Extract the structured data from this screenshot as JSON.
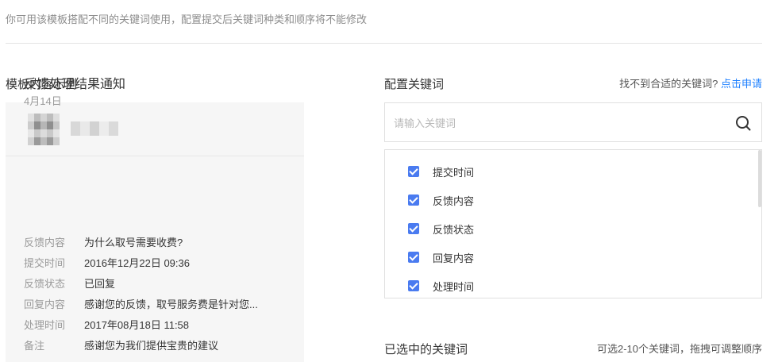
{
  "notice": "你可用该模板搭配不同的关键词使用，配置提交后关键词种类和顺序将不能修改",
  "template_section": {
    "title": "模板内容示例",
    "message": {
      "title": "反馈处理结果通知",
      "date": "4月14日",
      "fields": [
        {
          "key": "反馈内容",
          "value": "为什么取号需要收费?"
        },
        {
          "key": "提交时间",
          "value": "2016年12月22日 09:36"
        },
        {
          "key": "反馈状态",
          "value": "已回复"
        },
        {
          "key": "回复内容",
          "value": "感谢您的反馈，取号服务费是针对您..."
        },
        {
          "key": "处理时间",
          "value": "2017年08月18日 11:58"
        },
        {
          "key": "备注",
          "value": "感谢您为我们提供宝贵的建议"
        }
      ]
    }
  },
  "config_section": {
    "title": "配置关键词",
    "hint_text": "找不到合适的关键词?",
    "hint_link": "点击申请",
    "search": {
      "placeholder": "请输入关键词",
      "value": ""
    },
    "keywords": [
      {
        "label": "提交时间",
        "checked": true
      },
      {
        "label": "反馈内容",
        "checked": true
      },
      {
        "label": "反馈状态",
        "checked": true
      },
      {
        "label": "回复内容",
        "checked": true
      },
      {
        "label": "处理时间",
        "checked": true
      }
    ]
  },
  "selected_section": {
    "title": "已选中的关键词",
    "hint": "可选2-10个关键词，拖拽可调整顺序"
  },
  "colors": {
    "accent": "#4a7bf0",
    "link": "#1e80ff"
  }
}
